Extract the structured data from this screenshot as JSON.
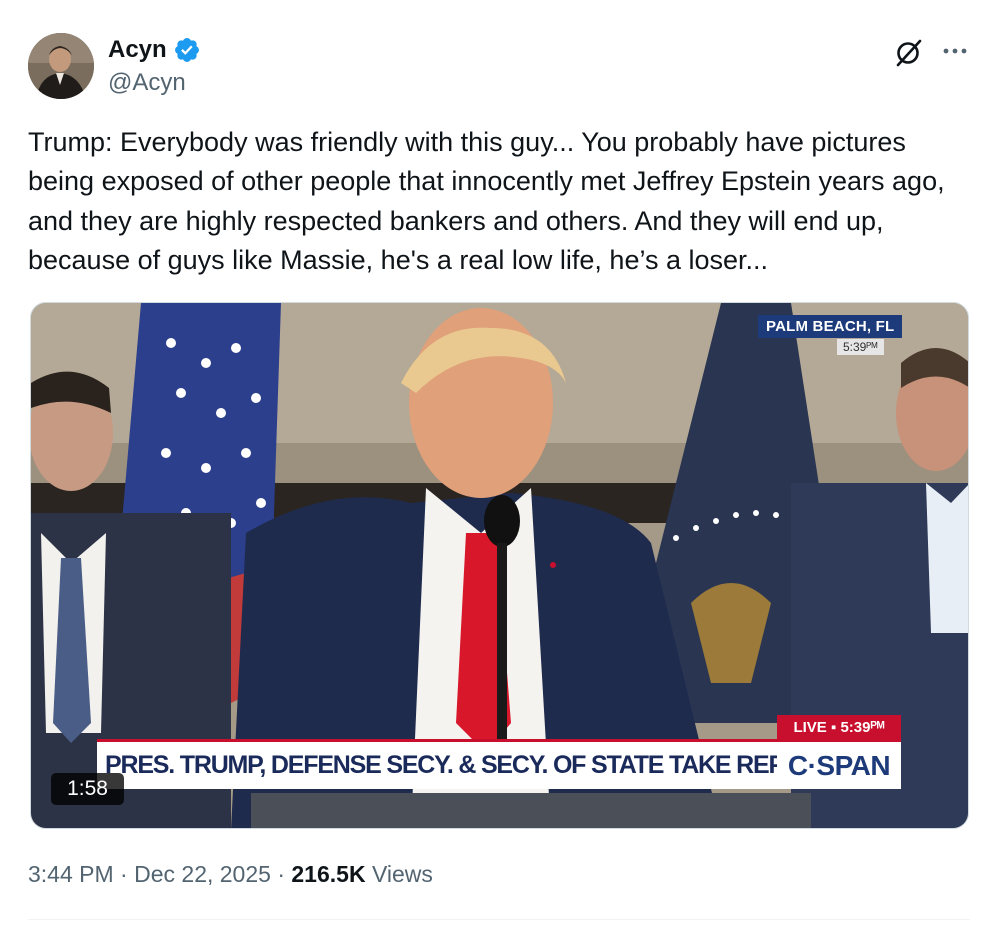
{
  "author": {
    "display_name": "Acyn",
    "handle": "@Acyn",
    "verified": true,
    "verified_color": "#1d9bf0"
  },
  "header_actions": {
    "grok_icon": "grok-slash-circle-icon",
    "more_icon": "more-horizontal-icon"
  },
  "tweet": {
    "text": "Trump: Everybody was friendly with this guy... You probably have pictures being exposed of other people that innocently met Jeffrey Epstein years ago, and they are highly respected bankers and others. And they will end up, because of guys like Massie, he's a real low life, he’s a loser..."
  },
  "media": {
    "location": "PALM BEACH, FL",
    "location_time": "5:39ᴾᴹ",
    "live_label": "LIVE ▪ 5:39ᴾᴹ",
    "chyron": "PRES. TRUMP, DEFENSE SECY. & SECY. OF STATE TAKE REPORTER QUESTIONS",
    "network": "C·SPAN",
    "duration": "1:58"
  },
  "meta": {
    "time": "3:44 PM",
    "separator": "·",
    "date": "Dec 22, 2025",
    "views_count": "216.5K",
    "views_label": "Views"
  }
}
